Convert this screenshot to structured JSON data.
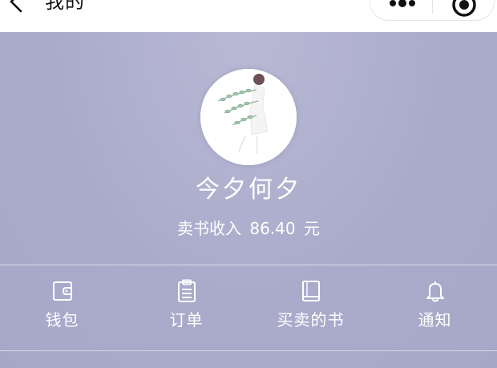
{
  "navbar": {
    "title": "我的",
    "back_icon": "chevron-left-icon",
    "capsule": {
      "more_icon": "more-dots-icon",
      "close_icon": "target-icon"
    }
  },
  "profile": {
    "nickname": "今夕何夕",
    "income_label": "卖书收入",
    "income_value": "86.40",
    "income_unit": "元",
    "background_color": "#aaabcb"
  },
  "menu": {
    "items": [
      {
        "label": "钱包",
        "icon": "wallet-icon"
      },
      {
        "label": "订单",
        "icon": "clipboard-icon"
      },
      {
        "label": "买卖的书",
        "icon": "book-icon"
      },
      {
        "label": "通知",
        "icon": "bell-icon"
      }
    ]
  }
}
